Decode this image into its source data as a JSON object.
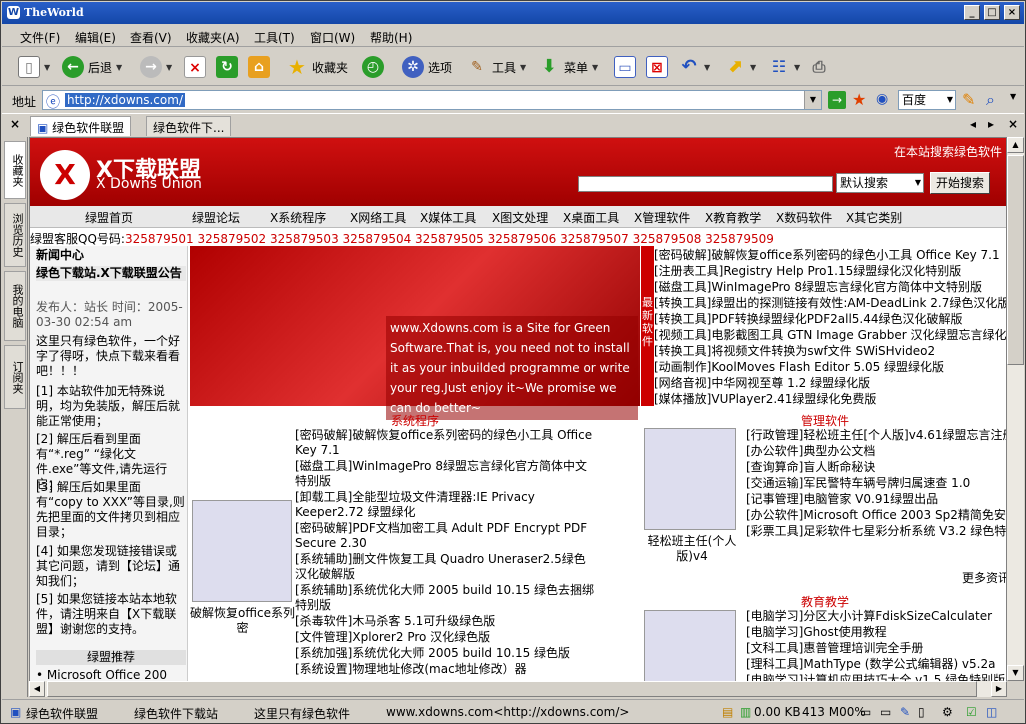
{
  "window": {
    "title": "TheWorld"
  },
  "menu": [
    "文件(F)",
    "编辑(E)",
    "查看(V)",
    "收藏夹(A)",
    "工具(T)",
    "窗口(W)",
    "帮助(H)"
  ],
  "toolbar": {
    "back": "后退",
    "favorites": "收藏夹",
    "options": "选项",
    "tools": "工具",
    "menu": "菜单"
  },
  "address": {
    "label": "地址",
    "url": "http://xdowns.com/",
    "search_engine": "百度"
  },
  "tabs": [
    "绿色软件联盟",
    "绿色软件下..."
  ],
  "sidebar_tabs": [
    "收藏夹",
    "浏览历史",
    "我的电脑",
    "订阅夹"
  ],
  "site": {
    "logo_char": "X",
    "brand": "X下载联盟",
    "brand_en": "X Downs Union",
    "search_label": "在本站搜索绿色软件",
    "search_option": "默认搜索",
    "search_button": "开始搜索",
    "nav": [
      "绿盟首页",
      "绿盟论坛",
      "X系统程序",
      "X网络工具",
      "X媒体工具",
      "X图文处理",
      "X桌面工具",
      "X管理软件",
      "X教育教学",
      "X数码软件",
      "X其它类别"
    ],
    "qq_label": "绿盟客服QQ号码:",
    "qq_numbers": "325879501 325879502 325879503 325879504 325879505 325879506 325879507 325879508 325879509",
    "news": {
      "header": "新闻中心",
      "title": "绿色下载站.X下载联盟公告",
      "meta": "发布人：站长 时间：2005-03-30 02:54 am",
      "body": "这里只有绿色软件，一个好字了得呀，快点下载来看看吧！！！",
      "items": [
        "[1] 本站软件加无特殊说明，均为免装版，解压后就能正常使用；",
        "[2] 解压后看到里面有“*.reg” “绿化文件.exe”等文件,请先运行它；",
        "[3] 解压后如果里面有“copy to XXX”等目录,则先把里面的文件拷贝到相应目录；",
        "[4] 如果您发现链接错误或其它问题，请到【论坛】通知我们；",
        "[5] 如果您链接本站本地软件，请注明来自【X下载联盟】谢谢您的支持。"
      ],
      "recommend_header": "绿盟推荐",
      "recommend_item": "• Microsoft Office 200"
    },
    "banner_text": "www.Xdowns.com is a Site for Green Software.That is, you need not to install it as your inbuilded programme or  write your reg.Just enjoy it~We promise we can do better~",
    "newest_label": "最新软件",
    "newest": [
      "[密码破解]破解恢复office系列密码的绿色小工具  Office Key 7.1",
      "[注册表工具]Registry Help Pro1.15绿盟绿化汉化特别版",
      "[磁盘工具]WinImagePro 8绿盟忘言绿化官方简体中文特别版",
      "[转换工具]绿盟出的探测链接有效性:AM-DeadLink 2.7绿色汉化版",
      "[转换工具]PDF转换绿盟绿化PDF2all5.44绿色汉化破解版",
      "[视频工具]电影截图工具  GTN Image Grabber 汉化绿盟忘言绿化版",
      "[转换工具]将视频文件转换为swf文件  SWiSHvideo2",
      "[动画制作]KoolMoves Flash Editor 5.05 绿盟绿化版",
      "[网络音视]中华网视至尊  1.2 绿盟绿化版",
      "[媒体播放]VUPlayer2.41绿盟绿化免费版"
    ],
    "sys": {
      "header": "系统程序",
      "caption": "破解恢复office系列密",
      "items": [
        "[密码破解]破解恢复office系列密码的绿色小工具  Office Key 7.1",
        "[磁盘工具]WinImagePro 8绿盟忘言绿化官方简体中文特别版",
        "[卸载工具]全能型垃圾文件清理器:IE Privacy Keeper2.72 绿盟绿化",
        "[密码破解]PDF文档加密工具  Adult PDF Encrypt PDF Secure 2.30",
        "[系统辅助]删文件恢复工具  Quadro Uneraser2.5绿色汉化破解版",
        "[系统辅助]系统优化大师  2005 build 10.15 绿色去捆绑特别版",
        "[杀毒软件]木马杀客  5.1可升级绿色版",
        "[文件管理]Xplorer2 Pro 汉化绿色版",
        "[系统加强]系统优化大师  2005 build 10.15 绿色版",
        "[系统设置]物理地址修改(mac地址修改）器"
      ]
    },
    "mgmt": {
      "header": "管理软件",
      "caption": "轻松班主任(个人版)v4",
      "items": [
        "[行政管理]轻松班主任[个人版]v4.61绿盟忘言注册从",
        "[办公软件]典型办公文档",
        "[查询算命]盲人断命秘诀",
        "[交通运输]军民警特车辆号牌归属速查  1.0",
        "[记事管理]电脑管家  V0.91绿盟出品",
        "[办公软件]Microsoft Office 2003 Sp2精简免安装绿色版",
        "[彩票工具]足彩软件七星彩分析系统  V3.2 绿色特别版"
      ],
      "more": "更多资讯"
    },
    "edu": {
      "header": "教育教学",
      "items": [
        "[电脑学习]分区大小计算FdiskSizeCalculater",
        "[电脑学习]Ghost使用教程",
        "[文科工具]惠普管理培训完全手册",
        "[理科工具]MathType (数学公式编辑器) v5.2a",
        "[电脑学习]计算机应用技巧大全  v1.5 绿色特别版"
      ]
    }
  },
  "status": {
    "items": [
      "绿色软件联盟",
      "绿色软件下载站",
      "这里只有绿色软件",
      "www.xdowns.com<http://xdowns.com/>"
    ],
    "speed": "0.00 KB",
    "memory": "413 M00%"
  },
  "colors": {
    "accent": "#c00000",
    "title_bar": "#1447a8",
    "selection": "#316ac5"
  }
}
